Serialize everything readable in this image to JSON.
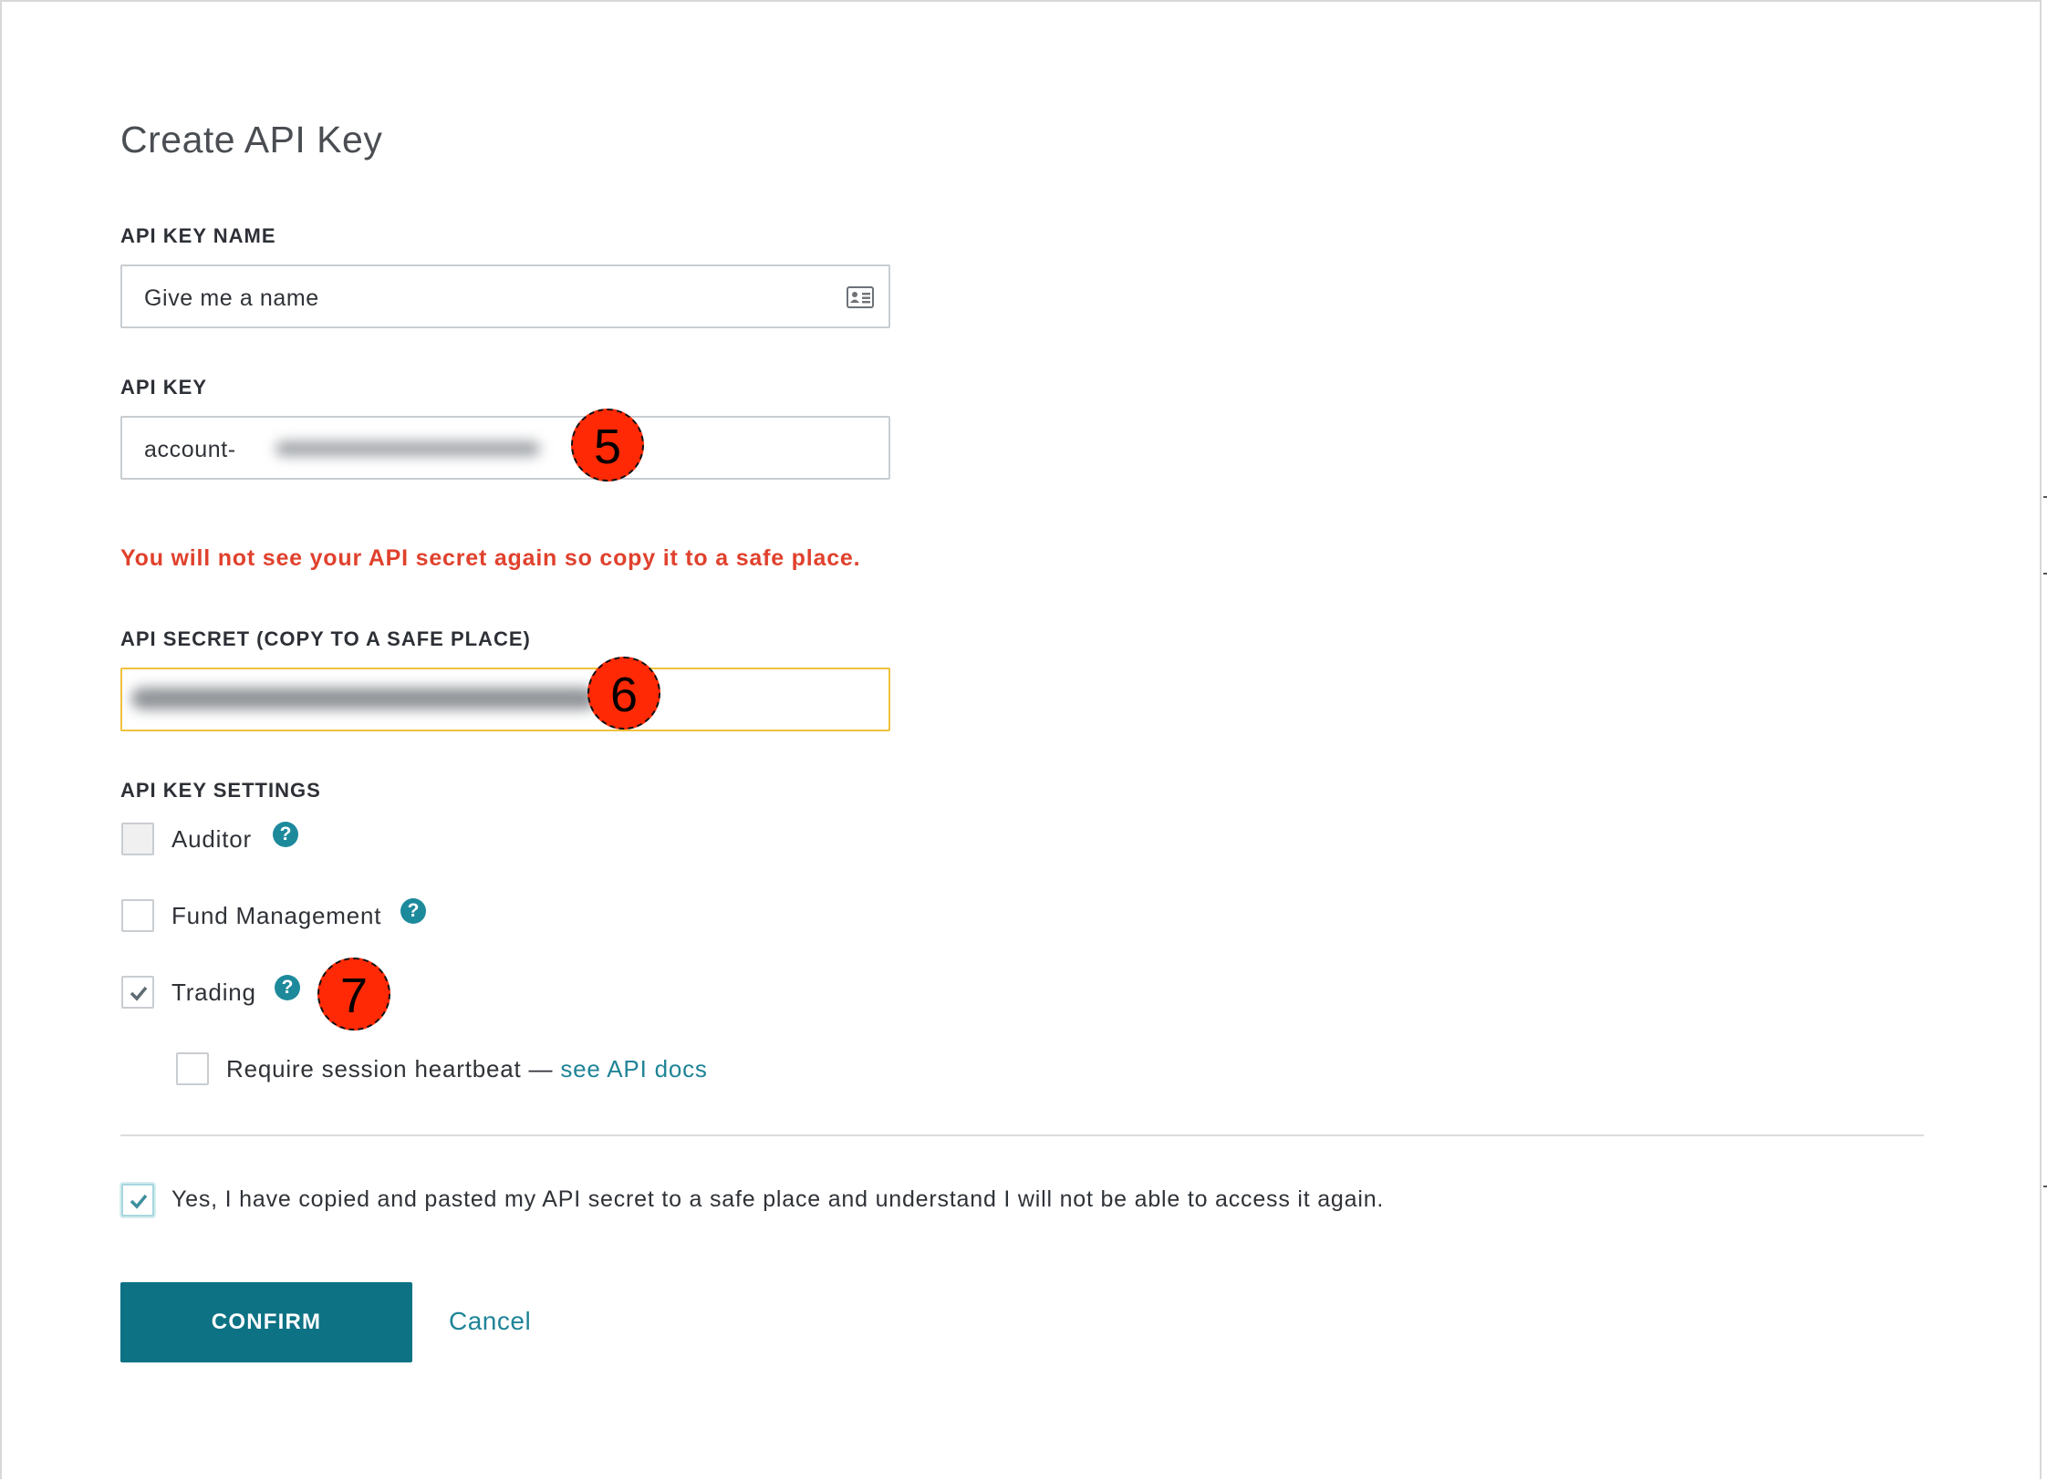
{
  "dialog": {
    "title": "Create API Key"
  },
  "api_key_name": {
    "label": "API KEY NAME",
    "value": "Give me a name",
    "icon": "contact-card-icon"
  },
  "api_key": {
    "label": "API KEY",
    "value": "account-"
  },
  "warning": "You will not see your API secret again so copy it to a safe place.",
  "api_secret": {
    "label": "API SECRET (COPY TO A SAFE PLACE)",
    "focus_color": "#f0c23b"
  },
  "settings": {
    "label": "API KEY SETTINGS",
    "options": [
      {
        "label": "Auditor",
        "checked": false,
        "disabled": true
      },
      {
        "label": "Fund Management",
        "checked": false
      },
      {
        "label": "Trading",
        "checked": true
      }
    ],
    "heartbeat": {
      "label": "Require session heartbeat — ",
      "link": "see API docs",
      "checked": false
    }
  },
  "acknowledge": {
    "text": "Yes, I have copied and pasted my API secret to a safe place and understand I will not be able to access it again.",
    "checked": true
  },
  "actions": {
    "confirm": "CONFIRM",
    "cancel": "Cancel"
  },
  "callouts": [
    "5",
    "6",
    "7"
  ],
  "colors": {
    "accent": "#0d7284",
    "link": "#1f8497",
    "warning": "#e0412d",
    "callout": "#ff2a05"
  }
}
